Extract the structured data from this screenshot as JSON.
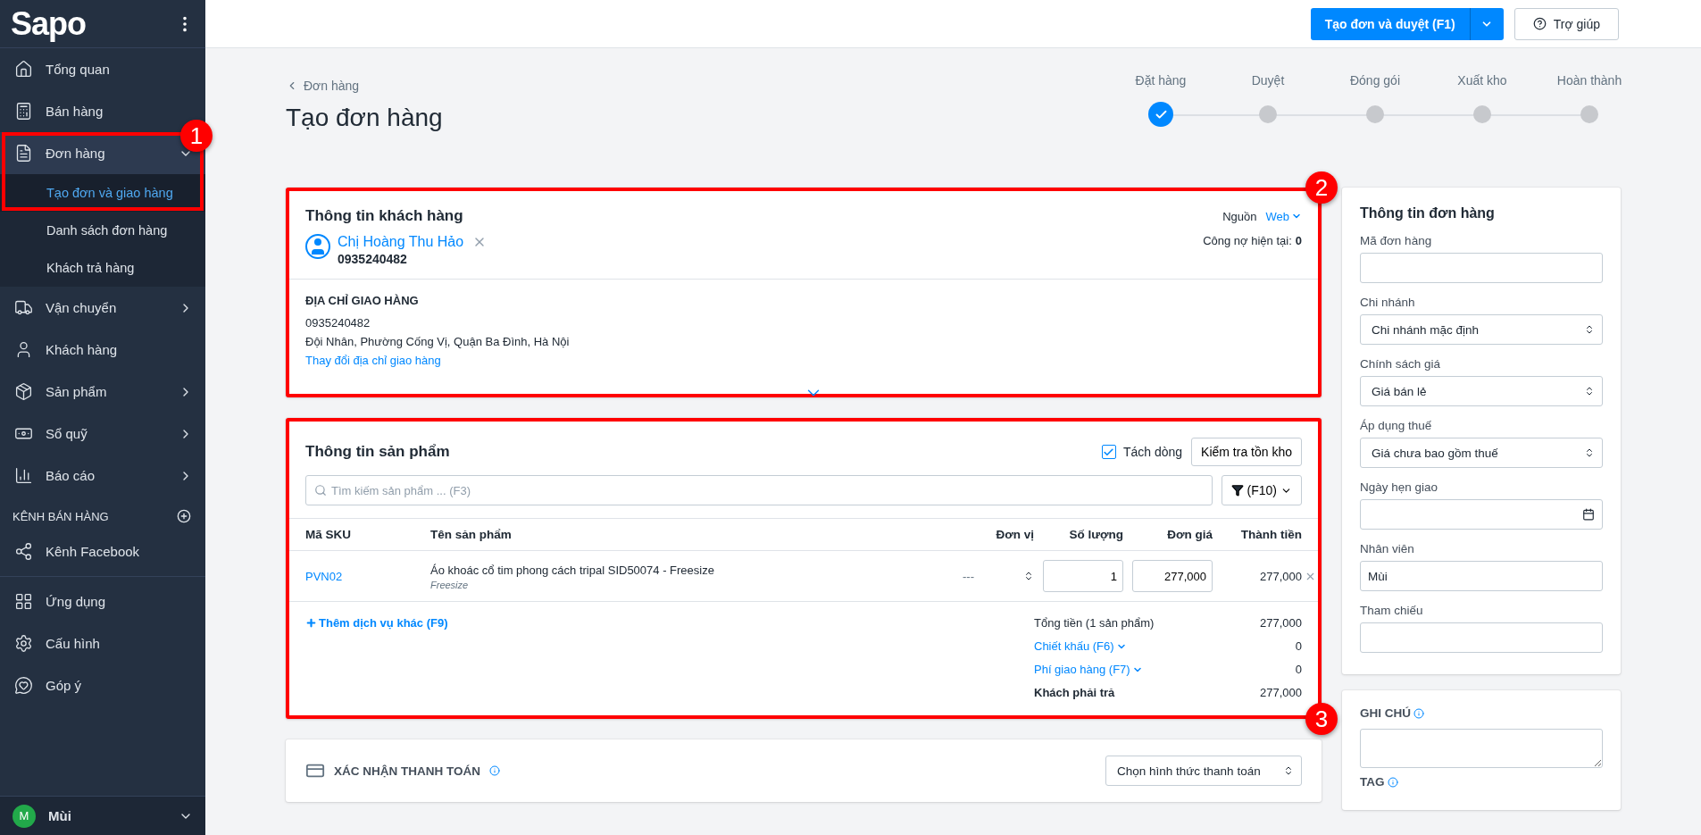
{
  "sidebar": {
    "logo": "Sapo",
    "items": [
      {
        "label": "Tổng quan",
        "selected": false
      },
      {
        "label": "Bán hàng",
        "selected": false
      },
      {
        "label": "Đơn hàng",
        "selected": true,
        "expanded": true,
        "annotation": "1",
        "children": [
          {
            "label": "Tạo đơn và giao hàng",
            "selected": true
          },
          {
            "label": "Danh sách đơn hàng",
            "selected": false
          },
          {
            "label": "Khách trả hàng",
            "selected": false
          }
        ]
      },
      {
        "label": "Vận chuyển",
        "selected": false,
        "expanded": false
      },
      {
        "label": "Khách hàng",
        "selected": false
      },
      {
        "label": "Sản phẩm",
        "selected": false,
        "expanded": false
      },
      {
        "label": "Sổ quỹ",
        "selected": false,
        "expanded": false
      },
      {
        "label": "Báo cáo",
        "selected": false,
        "expanded": false
      }
    ],
    "section": {
      "title": "KÊNH BÁN HÀNG",
      "items": [
        {
          "label": "Kênh Facebook",
          "selected": false
        }
      ]
    },
    "footer_items": [
      {
        "label": "Ứng dụng",
        "selected": false
      },
      {
        "label": "Cấu hình",
        "selected": false
      },
      {
        "label": "Góp ý",
        "selected": false
      }
    ],
    "user": {
      "initial": "M",
      "name": "Mùi"
    }
  },
  "header": {
    "primary_button": "Tạo đơn và duyệt (F1)",
    "help_button": "Trợ giúp"
  },
  "page": {
    "breadcrumb": "Đơn hàng",
    "title": "Tạo đơn hàng"
  },
  "steps": [
    {
      "label": "Đặt hàng",
      "done": true
    },
    {
      "label": "Duyệt",
      "done": false
    },
    {
      "label": "Đóng gói",
      "done": false
    },
    {
      "label": "Xuất kho",
      "done": false
    },
    {
      "label": "Hoàn thành",
      "done": false
    }
  ],
  "customer": {
    "annotation": "2",
    "title": "Thông tin khách hàng",
    "source_label": "Nguồn",
    "source_value": "Web",
    "name": "Chị Hoàng Thu Hảo",
    "phone": "0935240482",
    "debt_label": "Công nợ hiện tại:",
    "debt_value": "0",
    "address_title": "ĐỊA CHỈ GIAO HÀNG",
    "address_phone": "0935240482",
    "address": "Đội Nhân, Phường Cống Vị, Quận Ba Đình, Hà Nội",
    "change_link": "Thay đổi địa chỉ giao hàng"
  },
  "products": {
    "annotation": "3",
    "title": "Thông tin sản phẩm",
    "split_lines": {
      "label": "Tách dòng",
      "checked": true
    },
    "stock_button": "Kiểm tra tồn kho",
    "search": {
      "placeholder": "Tìm kiếm sản phẩm ... (F3)"
    },
    "filter_button": "(F10)",
    "columns": [
      "Mã SKU",
      "Tên sản phẩm",
      "Đơn vị",
      "Số lượng",
      "Đơn giá",
      "Thành tiền"
    ],
    "rows": [
      {
        "sku": "PVN02",
        "name": "Áo khoác cổ tim phong cách tripal SID50074 - Freesize",
        "variant": "Freesize",
        "unit": "---",
        "quantity": "1",
        "price": "277,000",
        "total": "277,000"
      }
    ],
    "add_service": "Thêm dịch vụ khác (F9)",
    "summary": [
      {
        "kind": "plain",
        "label": "Tổng tiền (1 sản phẩm)",
        "value": "277,000"
      },
      {
        "kind": "dropdown",
        "label": "Chiết khấu (F6)",
        "value": "0"
      },
      {
        "kind": "dropdown",
        "label": "Phí giao hàng (F7)",
        "value": "0"
      },
      {
        "kind": "total",
        "label": "Khách phải trả",
        "value": "277,000"
      }
    ]
  },
  "payment": {
    "title": "XÁC NHẬN THANH TOÁN",
    "select": "Chọn hình thức thanh toán"
  },
  "order_info": {
    "title": "Thông tin đơn hàng",
    "fields": [
      {
        "kind": "text",
        "label": "Mã đơn hàng"
      },
      {
        "kind": "select",
        "label": "Chi nhánh",
        "value": "Chi nhánh mặc định"
      },
      {
        "kind": "select",
        "label": "Chính sách giá",
        "value": "Giá bán lẻ"
      },
      {
        "kind": "select",
        "label": "Áp dụng thuế",
        "value": "Giá chưa bao gồm thuế"
      },
      {
        "kind": "date",
        "label": "Ngày hẹn giao"
      },
      {
        "kind": "text",
        "label": "Nhân viên",
        "value": "Mùi"
      },
      {
        "kind": "text",
        "label": "Tham chiếu"
      }
    ]
  },
  "notes": {
    "title": "GHI CHÚ",
    "tag_title": "TAG"
  }
}
